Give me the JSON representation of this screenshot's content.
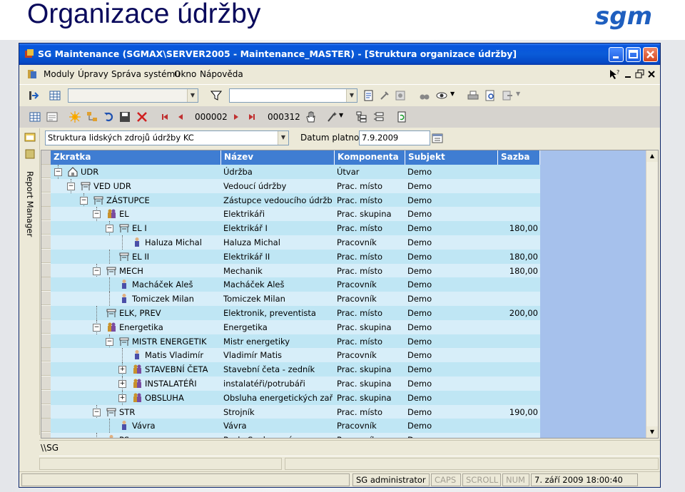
{
  "slide": {
    "title": "Organizace údržby",
    "logo_text": "sgm"
  },
  "window": {
    "title": "SG Maintenance (SGMAX\\SERVER2005 - Maintenance_MASTER) - [Struktura organizace údržby]"
  },
  "menu": [
    "Moduly",
    "Úpravy",
    "Správa systému",
    "Okno",
    "Nápověda"
  ],
  "navigator": {
    "first_record": "000002",
    "last_record": "000312"
  },
  "filter": {
    "structure_value": "Struktura lidských zdrojů údržby KC",
    "date_label": "Datum platnosti:",
    "date_value": "7.9.2009"
  },
  "side_panel": {
    "label": "Report Manager"
  },
  "grid": {
    "columns": [
      "Zkratka",
      "Název",
      "Komponenta",
      "Subjekt",
      "Sazba"
    ],
    "rows": [
      {
        "zkratka": "UDR",
        "nazev": "Údržba",
        "komponenta": "Útvar",
        "subjekt": "Demo",
        "sazba": ""
      },
      {
        "zkratka": "VED UDR",
        "nazev": "Vedoucí údržby",
        "komponenta": "Prac. místo",
        "subjekt": "Demo",
        "sazba": ""
      },
      {
        "zkratka": "ZÁSTUPCE",
        "nazev": "Zástupce vedoucího údržby",
        "komponenta": "Prac. místo",
        "subjekt": "Demo",
        "sazba": ""
      },
      {
        "zkratka": "EL",
        "nazev": "Elektrikáři",
        "komponenta": "Prac. skupina",
        "subjekt": "Demo",
        "sazba": ""
      },
      {
        "zkratka": "EL I",
        "nazev": "Elektrikář I",
        "komponenta": "Prac. místo",
        "subjekt": "Demo",
        "sazba": "180,00"
      },
      {
        "zkratka": "Haluza Michal",
        "nazev": "Haluza Michal",
        "komponenta": "Pracovník",
        "subjekt": "Demo",
        "sazba": ""
      },
      {
        "zkratka": "EL II",
        "nazev": "Elektrikář II",
        "komponenta": "Prac. místo",
        "subjekt": "Demo",
        "sazba": "180,00"
      },
      {
        "zkratka": "MECH",
        "nazev": "Mechanik",
        "komponenta": "Prac. místo",
        "subjekt": "Demo",
        "sazba": "180,00"
      },
      {
        "zkratka": "Macháček Aleš",
        "nazev": "Macháček Aleš",
        "komponenta": "Pracovník",
        "subjekt": "Demo",
        "sazba": ""
      },
      {
        "zkratka": "Tomiczek Milan",
        "nazev": "Tomiczek Milan",
        "komponenta": "Pracovník",
        "subjekt": "Demo",
        "sazba": ""
      },
      {
        "zkratka": "ELK, PREV",
        "nazev": "Elektronik, preventista",
        "komponenta": "Prac. místo",
        "subjekt": "Demo",
        "sazba": "200,00"
      },
      {
        "zkratka": "Energetika",
        "nazev": "Energetika",
        "komponenta": "Prac. skupina",
        "subjekt": "Demo",
        "sazba": ""
      },
      {
        "zkratka": "MISTR ENERGETIK",
        "nazev": "Mistr energetiky",
        "komponenta": "Prac. místo",
        "subjekt": "Demo",
        "sazba": ""
      },
      {
        "zkratka": "Matis Vladimír",
        "nazev": "Vladimír Matis",
        "komponenta": "Pracovník",
        "subjekt": "Demo",
        "sazba": ""
      },
      {
        "zkratka": "STAVEBNÍ ČETA",
        "nazev": "Stavební četa - zedník",
        "komponenta": "Prac. skupina",
        "subjekt": "Demo",
        "sazba": ""
      },
      {
        "zkratka": "INSTALATÉŘI",
        "nazev": "instalatéři/potrubáři",
        "komponenta": "Prac. skupina",
        "subjekt": "Demo",
        "sazba": ""
      },
      {
        "zkratka": "OBSLUHA",
        "nazev": "Obsluha energetických zařízení",
        "komponenta": "Prac. skupina",
        "subjekt": "Demo",
        "sazba": ""
      },
      {
        "zkratka": "STR",
        "nazev": "Strojník",
        "komponenta": "Prac. místo",
        "subjekt": "Demo",
        "sazba": "190,00"
      },
      {
        "zkratka": "Vávra",
        "nazev": "Vávra",
        "komponenta": "Pracovník",
        "subjekt": "Demo",
        "sazba": ""
      },
      {
        "zkratka": "PS",
        "nazev": "Pavla Soukupová",
        "komponenta": "Pracovník",
        "subjekt": "Demo",
        "sazba": ""
      }
    ]
  },
  "path": "\\\\SG",
  "status": {
    "user": "SG administrator",
    "caps": "CAPS",
    "scroll": "SCROLL",
    "num": "NUM",
    "datetime": "7. září 2009 18:00:40"
  },
  "colors": {
    "title_blue": "#0a0a5c",
    "header_blue": "#3f7dd2",
    "row_odd": "#bfe6f4",
    "row_even": "#d7eef9",
    "logo_blue": "#1f5fbf"
  }
}
